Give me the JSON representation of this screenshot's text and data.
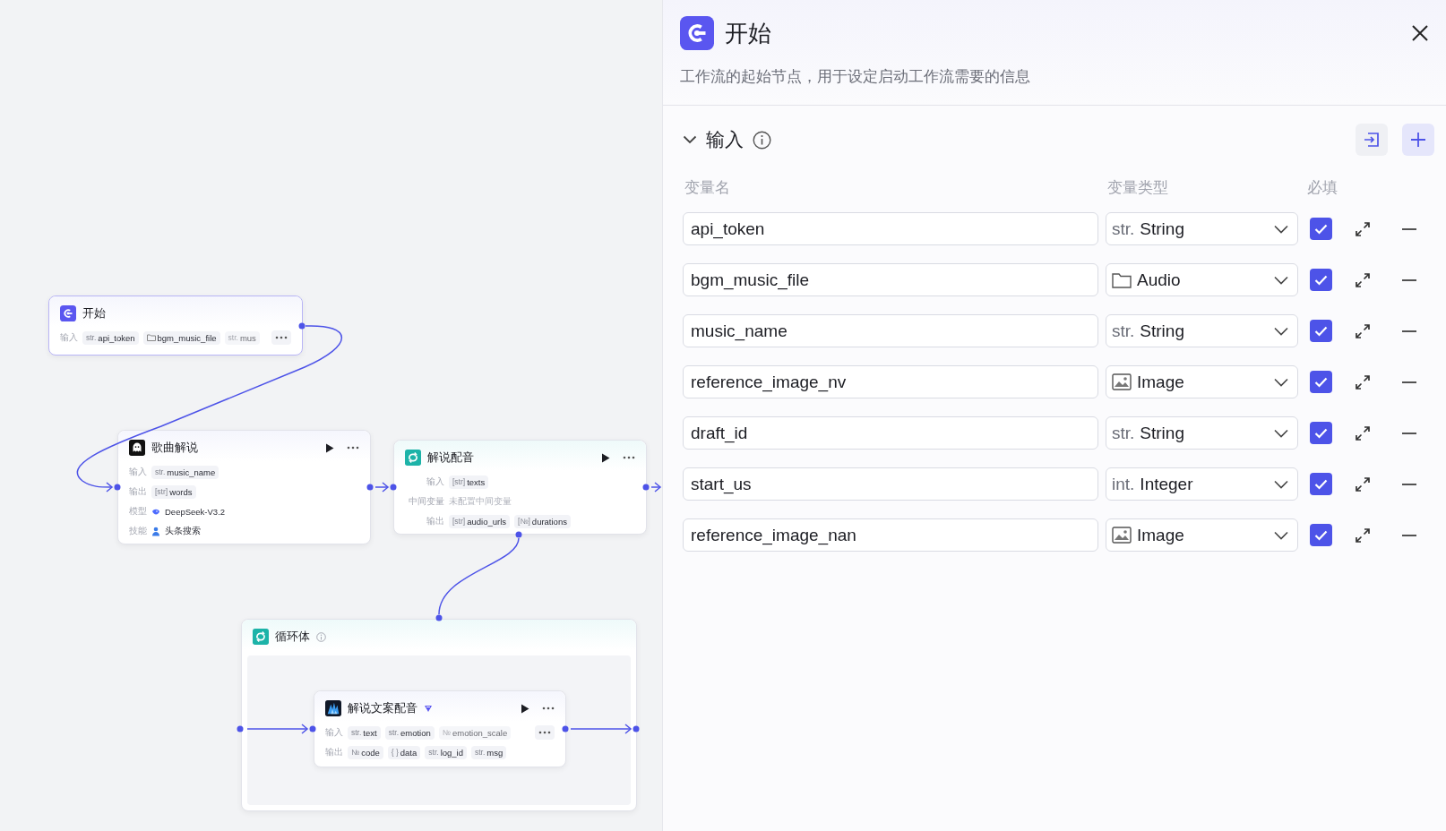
{
  "canvas": {
    "nodes": [
      {
        "kind": "start",
        "title": "开始",
        "selected": true,
        "rows": [
          {
            "kind": "tags",
            "label": "输入",
            "more": true,
            "tags": [
              {
                "type": "str.",
                "name": "api_token",
                "faded": false
              },
              {
                "kind": "file",
                "name": "bgm_music_file",
                "faded": false
              },
              {
                "type": "str.",
                "name": "mus",
                "faded": true
              }
            ]
          }
        ]
      },
      {
        "kind": "llm",
        "title": "歌曲解说",
        "selected": false,
        "rows": [
          {
            "kind": "tags",
            "label": "输入",
            "more": false,
            "tags": [
              {
                "type": "str.",
                "name": "music_name",
                "faded": false
              }
            ]
          },
          {
            "kind": "tags",
            "label": "输出",
            "more": false,
            "tags": [
              {
                "type": "[str]",
                "name": "words",
                "faded": false
              }
            ]
          },
          {
            "kind": "model",
            "label": "模型",
            "value": "DeepSeek-V3.2"
          },
          {
            "kind": "skill",
            "label": "技能",
            "value": "头条搜索"
          }
        ]
      },
      {
        "kind": "batch",
        "title": "解说配音",
        "selected": false,
        "rows": [
          {
            "kind": "tags",
            "label": "输入",
            "more": false,
            "tags": [
              {
                "type": "[str]",
                "name": "texts",
                "faded": false
              }
            ]
          },
          {
            "kind": "text",
            "label": "中间变量",
            "value": "未配置中间变量"
          },
          {
            "kind": "tags",
            "label": "输出",
            "more": false,
            "tags": [
              {
                "type": "[str]",
                "name": "audio_urls",
                "faded": false
              },
              {
                "type": "[№]",
                "name": "durations",
                "faded": false
              }
            ]
          }
        ]
      },
      {
        "kind": "loop",
        "title": "循环体",
        "selected": false,
        "children": [
          {
            "kind": "plugin",
            "title": "解说文案配音",
            "selected": false,
            "rows": [
              {
                "kind": "tags",
                "label": "输入",
                "more": true,
                "tags": [
                  {
                    "type": "str.",
                    "name": "text",
                    "faded": false
                  },
                  {
                    "type": "str.",
                    "name": "emotion",
                    "faded": false
                  },
                  {
                    "type": "№",
                    "name": "emotion_scale",
                    "faded": true
                  }
                ]
              },
              {
                "kind": "tags",
                "label": "输出",
                "more": false,
                "tags": [
                  {
                    "type": "№",
                    "name": "code",
                    "faded": false
                  },
                  {
                    "type": "{ }",
                    "name": "data",
                    "faded": false
                  },
                  {
                    "type": "str.",
                    "name": "log_id",
                    "faded": false
                  },
                  {
                    "type": "str.",
                    "name": "msg",
                    "faded": false
                  }
                ]
              }
            ]
          }
        ]
      }
    ]
  },
  "panel": {
    "title": "开始",
    "description": "工作流的起始节点，用于设定启动工作流需要的信息",
    "section": {
      "title": "输入",
      "expanded": true,
      "columns": [
        "变量名",
        "变量类型",
        "必填"
      ],
      "variables": [
        {
          "name": "api_token",
          "kind": "str",
          "type_prefix": "str.",
          "type_label": "String",
          "required": true
        },
        {
          "name": "bgm_music_file",
          "kind": "audio",
          "type_label": "Audio",
          "required": true
        },
        {
          "name": "music_name",
          "kind": "str",
          "type_prefix": "str.",
          "type_label": "String",
          "required": true
        },
        {
          "name": "reference_image_nv",
          "kind": "image",
          "type_label": "Image",
          "required": true
        },
        {
          "name": "draft_id",
          "kind": "str",
          "type_prefix": "str.",
          "type_label": "String",
          "required": true
        },
        {
          "name": "start_us",
          "kind": "int",
          "type_prefix": "int.",
          "type_label": "Integer",
          "required": true
        },
        {
          "name": "reference_image_nan",
          "kind": "image",
          "type_label": "Image",
          "required": true
        }
      ]
    }
  }
}
